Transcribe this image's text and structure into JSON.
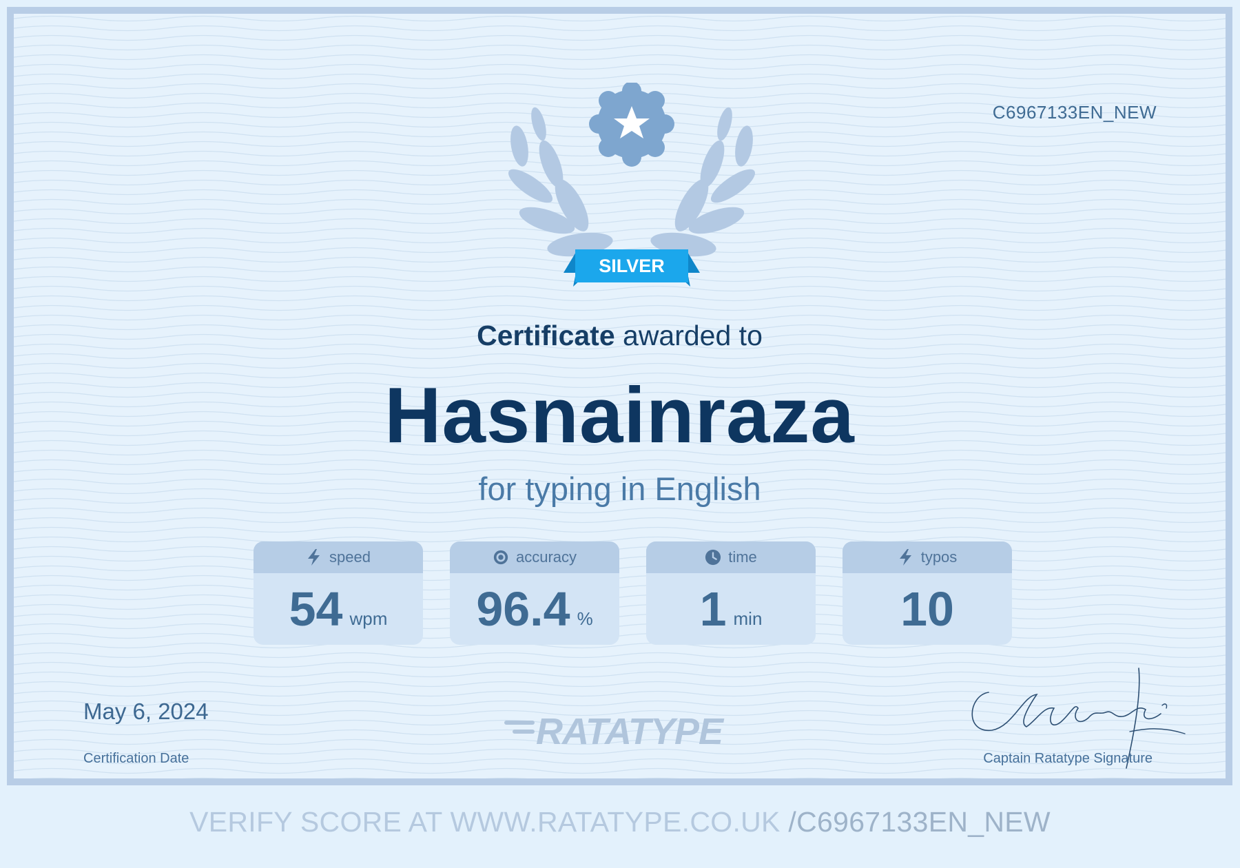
{
  "certificate": {
    "id": "C6967133EN_NEW",
    "badge_label": "SILVER",
    "heading_strong": "Certificate",
    "heading_rest": " awarded to",
    "recipient": "Hasnainraza",
    "subtitle": "for typing in English",
    "stats": [
      {
        "label": "speed",
        "value": "54",
        "unit": "wpm",
        "icon": "lightning-icon"
      },
      {
        "label": "accuracy",
        "value": "96.4",
        "unit": "%",
        "icon": "target-icon"
      },
      {
        "label": "time",
        "value": "1",
        "unit": "min",
        "icon": "clock-icon"
      },
      {
        "label": "typos",
        "value": "10",
        "unit": "",
        "icon": "lightning-icon"
      }
    ],
    "date": "May 6, 2024",
    "date_label": "Certification Date",
    "logo_text": "RATATYPE",
    "signature_text": "CRatatype fé",
    "signature_label": "Captain Ratatype Signature"
  },
  "footer": {
    "verify_prefix": "VERIFY SCORE AT WWW.RATATYPE.CO.UK ",
    "verify_suffix": "/C6967133EN_NEW"
  },
  "colors": {
    "page_background": "#e3f1fc",
    "frame_border": "#b8cde6",
    "name_navy": "#0e3660",
    "badge_blue": "#1ba7ec",
    "stat_text": "#3f6b93"
  }
}
